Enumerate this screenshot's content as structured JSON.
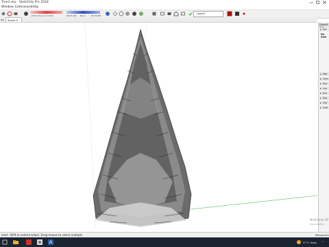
{
  "window": {
    "title": "Tree3.skp - SketchUp Pro 2018"
  },
  "menu": {
    "items": [
      "Window",
      "Extensions",
      "Help"
    ]
  },
  "toolbar": {
    "shadow_time_left": "09:03 AM",
    "shadow_time_mid": "Noon",
    "shadow_time_right": "05:30 PM",
    "month_letters": "J F M A M J J A S O N D",
    "layer_label": "Layer0"
  },
  "tabs": {
    "scene_label": "Scene 5"
  },
  "tray": {
    "header": "Default Tray",
    "entity_info": "Ent",
    "no_selection": "No Sele",
    "panels": [
      "Mat",
      "Com",
      "Styl",
      "Lay",
      "Sce",
      "Sha",
      "Inst",
      "Outl"
    ]
  },
  "status": {
    "message": "elect. Shift to extend select. Drag mouse to select multiple.",
    "measurements_label": "Measurem"
  },
  "taskbar": {
    "weather": "27°C Haze"
  },
  "watermark": {
    "line1": "Activate W",
    "line2": "Go to Settin"
  }
}
